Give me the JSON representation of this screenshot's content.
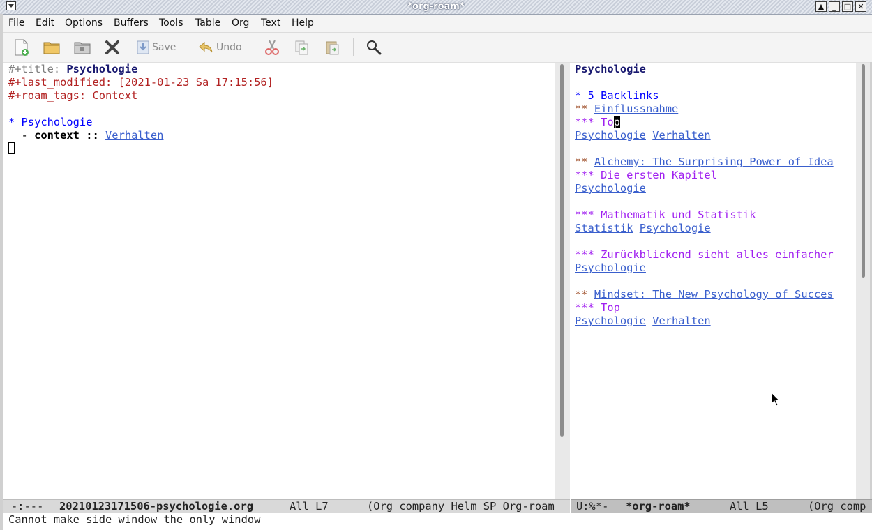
{
  "window": {
    "title": "*org-roam*",
    "buttons": [
      "▲",
      "_",
      "□",
      "✕"
    ]
  },
  "menubar": [
    "File",
    "Edit",
    "Options",
    "Buffers",
    "Tools",
    "Table",
    "Org",
    "Text",
    "Help"
  ],
  "toolbar": {
    "save_label": "Save",
    "undo_label": "Undo",
    "icons": [
      "new-file-icon",
      "open-folder-icon",
      "open-directory-icon",
      "close-icon",
      "save-icon",
      "undo-icon",
      "cut-icon",
      "copy-icon",
      "paste-icon",
      "search-icon"
    ]
  },
  "left_buffer": {
    "l1_key": "#+title: ",
    "l1_val": "Psychologie",
    "l2": "#+last_modified: [2021-01-23 Sa 17:15:56]",
    "l3": "#+roam_tags: Context",
    "l5": "* Psychologie",
    "l6_dash": "  - ",
    "l6_term": "context",
    "l6_sep": " :: ",
    "l6_link": "Verhalten"
  },
  "right_buffer": {
    "title": "Psychologie",
    "backlinks_heading": "* 5 Backlinks",
    "entries": [
      {
        "stars2": "** ",
        "source": "Einflussnahme",
        "stars3": "*** ",
        "heading": "To",
        "heading_cursor": "p",
        "links": [
          "Psychologie",
          "Verhalten"
        ]
      },
      {
        "stars2": "** ",
        "source": "Alchemy: The Surprising Power of Idea",
        "stars3": "*** ",
        "heading": "Die ersten Kapitel",
        "links": [
          "Psychologie"
        ]
      },
      {
        "stars3": "*** ",
        "heading": "Mathematik und Statistik",
        "links": [
          "Statistik",
          "Psychologie"
        ]
      },
      {
        "stars3": "*** ",
        "heading": "Zurückblickend sieht alles einfacher",
        "links": [
          "Psychologie"
        ]
      },
      {
        "stars2": "** ",
        "source": "Mindset: The New Psychology of Succes",
        "stars3": "*** ",
        "heading": "Top",
        "links": [
          "Psychologie",
          "Verhalten"
        ]
      }
    ]
  },
  "modeline_left": {
    "status": "-:---",
    "buffer": "20210123171506-psychologie.org",
    "position": "All L7",
    "modes": "(Org company Helm SP Org-roam"
  },
  "modeline_right": {
    "status": "U:%*-",
    "buffer": "*org-roam*",
    "position": "All L5",
    "modes": "(Org comp"
  },
  "echo": "Cannot make side window the only window",
  "colors": {
    "link": "#3a5fcd",
    "heading1": "#0000ff",
    "heading2": "#a0522d",
    "heading3": "#a020f0",
    "meta_red": "#b22222",
    "title": "#191970"
  }
}
